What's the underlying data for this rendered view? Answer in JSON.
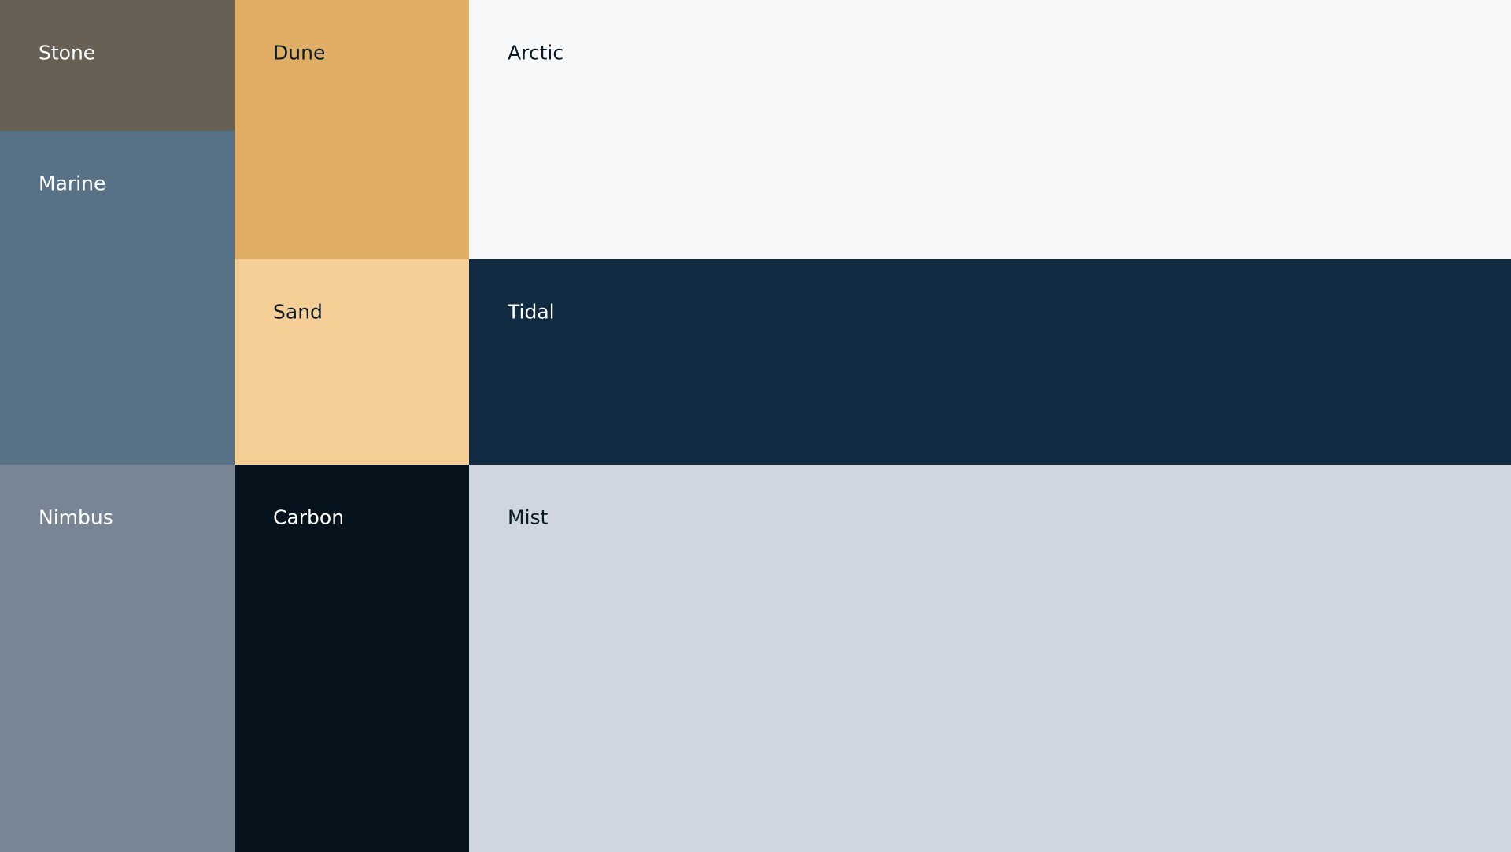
{
  "swatches": [
    {
      "id": "sw-stone",
      "name": "Stone",
      "color": "#696055",
      "text_color": "#ffffff"
    },
    {
      "id": "sw-marine",
      "name": "Marine",
      "color": "#577186",
      "text_color": "#ffffff"
    },
    {
      "id": "sw-nimbus",
      "name": "Nimbus",
      "color": "#788594",
      "text_color": "#ffffff"
    },
    {
      "id": "sw-dune",
      "name": "Dune",
      "color": "#e0ad65",
      "text_color": "#0a1a26"
    },
    {
      "id": "sw-sand",
      "name": "Sand",
      "color": "#f4ce94",
      "text_color": "#0a1a26"
    },
    {
      "id": "sw-carbon",
      "name": "Carbon",
      "color": "#06121c",
      "text_color": "#ffffff"
    },
    {
      "id": "sw-arctic",
      "name": "Arctic",
      "color": "#f7f8fa",
      "text_color": "#0a1a26"
    },
    {
      "id": "sw-tidal",
      "name": "Tidal",
      "color": "#112b42",
      "text_color": "#ffffff"
    },
    {
      "id": "sw-mist",
      "name": "Mist",
      "color": "#cfd6df",
      "text_color": "#0a1a26"
    }
  ]
}
